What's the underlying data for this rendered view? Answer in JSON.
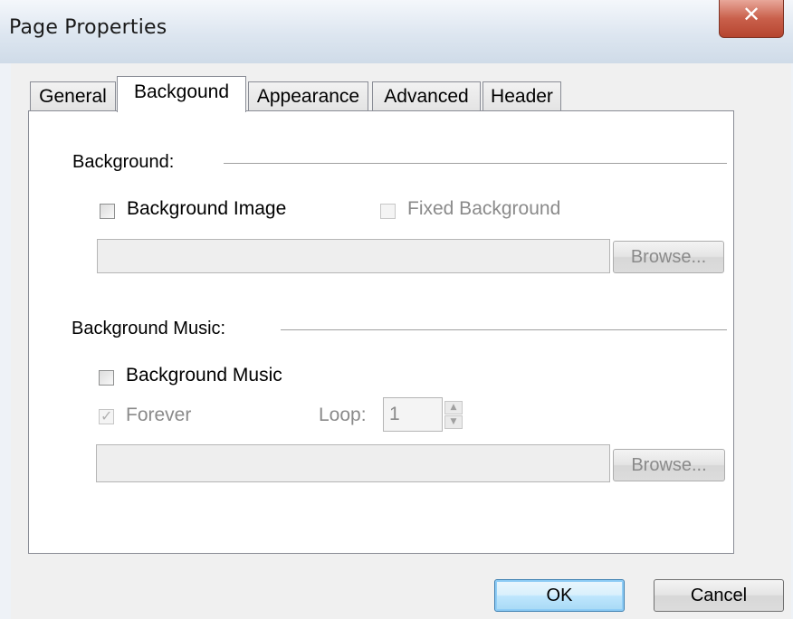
{
  "window": {
    "title": "Page Properties",
    "close_glyph": "✕"
  },
  "tabs": [
    {
      "label": "General"
    },
    {
      "label": "Backgound"
    },
    {
      "label": "Appearance"
    },
    {
      "label": "Advanced"
    },
    {
      "label": "Header"
    }
  ],
  "active_tab": "Backgound",
  "background_group": {
    "label": "Background:",
    "background_image": {
      "label": "Background Image",
      "checked": false,
      "enabled": true
    },
    "fixed_background": {
      "label": "Fixed Background",
      "checked": false,
      "enabled": false
    },
    "path_value": "",
    "browse_label": "Browse..."
  },
  "music_group": {
    "label": "Background Music:",
    "background_music": {
      "label": "Background Music",
      "checked": false,
      "enabled": true
    },
    "forever": {
      "label": "Forever",
      "checked": true,
      "enabled": false
    },
    "loop_label": "Loop:",
    "loop_value": "1",
    "path_value": "",
    "browse_label": "Browse..."
  },
  "footer": {
    "ok_label": "OK",
    "cancel_label": "Cancel"
  },
  "colors": {
    "title_bar": "#dde6f0",
    "close_button": "#c9604b",
    "default_button": "#bee6fd"
  }
}
